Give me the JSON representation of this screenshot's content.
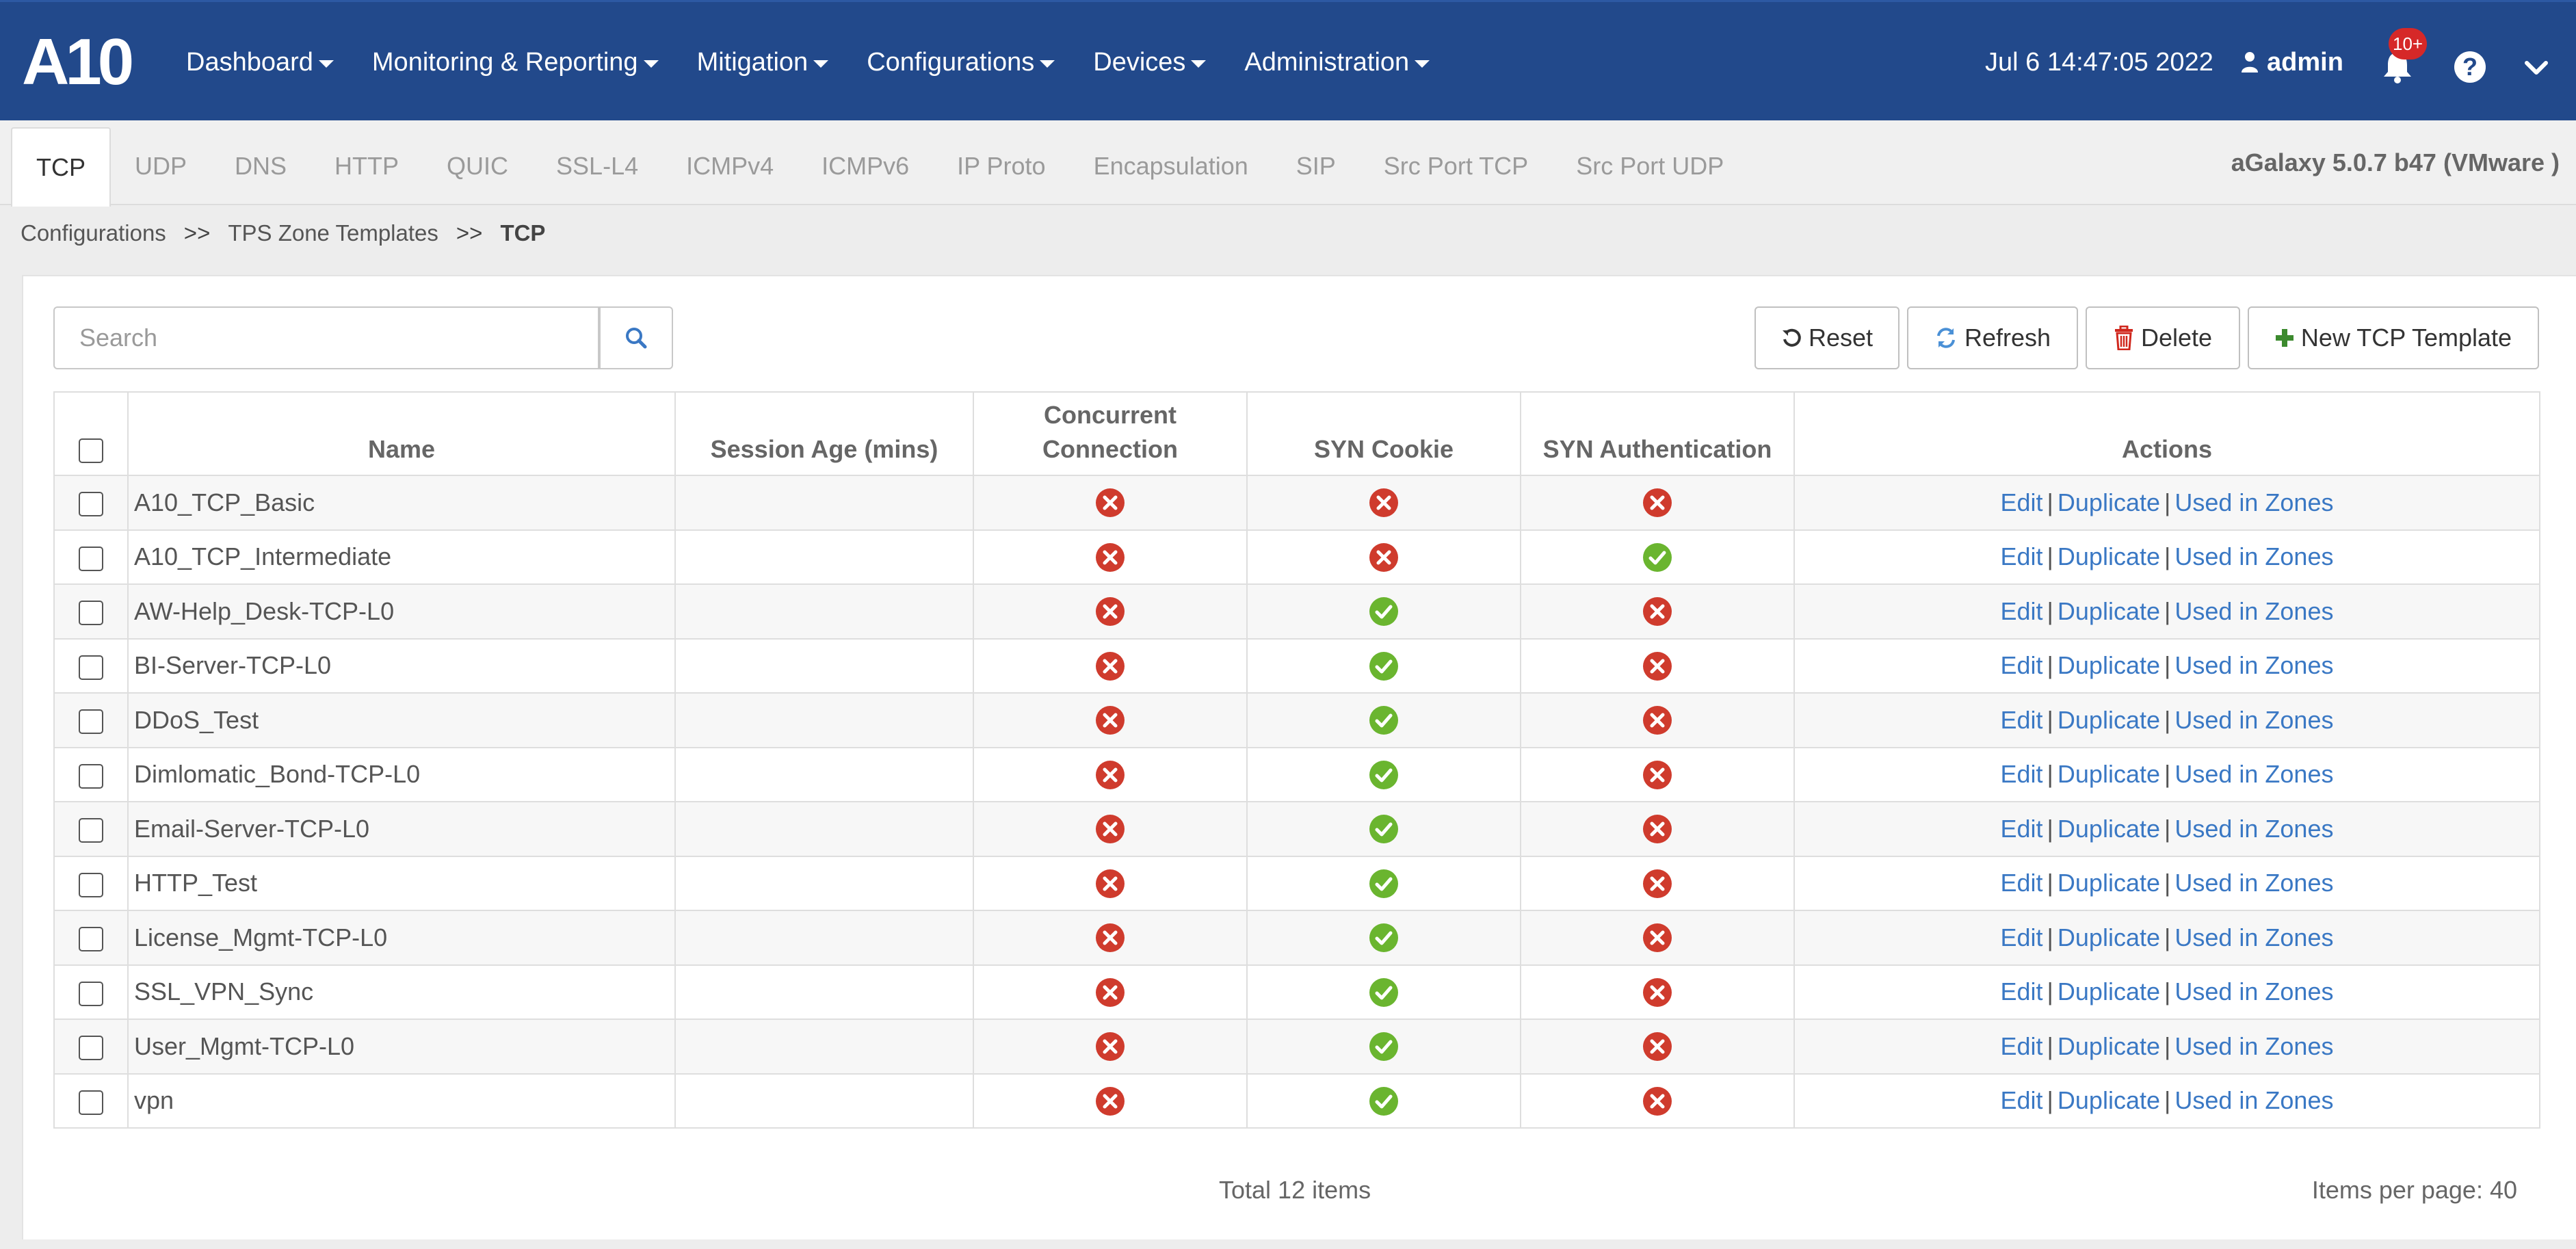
{
  "nav": {
    "logo_text": "A10",
    "menus": [
      {
        "label": "Dashboard",
        "name": "menu-dashboard"
      },
      {
        "label": "Monitoring & Reporting",
        "name": "menu-monitoring-reporting"
      },
      {
        "label": "Mitigation",
        "name": "menu-mitigation"
      },
      {
        "label": "Configurations",
        "name": "menu-configurations"
      },
      {
        "label": "Devices",
        "name": "menu-devices"
      },
      {
        "label": "Administration",
        "name": "menu-administration"
      }
    ],
    "datetime": "Jul 6 14:47:05 2022",
    "user": "admin",
    "notification_badge": "10+",
    "help_glyph": "?"
  },
  "tabs": [
    {
      "label": "TCP",
      "active": true
    },
    {
      "label": "UDP"
    },
    {
      "label": "DNS"
    },
    {
      "label": "HTTP"
    },
    {
      "label": "QUIC"
    },
    {
      "label": "SSL-L4"
    },
    {
      "label": "ICMPv4"
    },
    {
      "label": "ICMPv6"
    },
    {
      "label": "IP Proto"
    },
    {
      "label": "Encapsulation"
    },
    {
      "label": "SIP"
    },
    {
      "label": "Src Port TCP"
    },
    {
      "label": "Src Port UDP"
    }
  ],
  "version": "aGalaxy 5.0.7 b47 (VMware )",
  "breadcrumb": {
    "items": [
      "Configurations",
      "TPS Zone Templates",
      "TCP"
    ],
    "separator": ">>"
  },
  "search": {
    "placeholder": "Search"
  },
  "toolbar": {
    "reset": "Reset",
    "refresh": "Refresh",
    "delete": "Delete",
    "new": "New TCP Template"
  },
  "table": {
    "headers": {
      "name": "Name",
      "session_age": "Session Age (mins)",
      "concurrent_line1": "Concurrent",
      "concurrent_line2": "Connection",
      "syn_cookie": "SYN Cookie",
      "syn_auth": "SYN Authentication",
      "actions": "Actions"
    },
    "action_labels": {
      "edit": "Edit",
      "duplicate": "Duplicate",
      "used": "Used in Zones",
      "separator": "|"
    },
    "rows": [
      {
        "name": "A10_TCP_Basic",
        "session_age": "",
        "concurrent": false,
        "syn_cookie": false,
        "syn_auth": false
      },
      {
        "name": "A10_TCP_Intermediate",
        "session_age": "",
        "concurrent": false,
        "syn_cookie": false,
        "syn_auth": true
      },
      {
        "name": "AW-Help_Desk-TCP-L0",
        "session_age": "",
        "concurrent": false,
        "syn_cookie": true,
        "syn_auth": false
      },
      {
        "name": "BI-Server-TCP-L0",
        "session_age": "",
        "concurrent": false,
        "syn_cookie": true,
        "syn_auth": false
      },
      {
        "name": "DDoS_Test",
        "session_age": "",
        "concurrent": false,
        "syn_cookie": true,
        "syn_auth": false
      },
      {
        "name": "Dimlomatic_Bond-TCP-L0",
        "session_age": "",
        "concurrent": false,
        "syn_cookie": true,
        "syn_auth": false
      },
      {
        "name": "Email-Server-TCP-L0",
        "session_age": "",
        "concurrent": false,
        "syn_cookie": true,
        "syn_auth": false
      },
      {
        "name": "HTTP_Test",
        "session_age": "",
        "concurrent": false,
        "syn_cookie": true,
        "syn_auth": false
      },
      {
        "name": "License_Mgmt-TCP-L0",
        "session_age": "",
        "concurrent": false,
        "syn_cookie": true,
        "syn_auth": false
      },
      {
        "name": "SSL_VPN_Sync",
        "session_age": "",
        "concurrent": false,
        "syn_cookie": true,
        "syn_auth": false
      },
      {
        "name": "User_Mgmt-TCP-L0",
        "session_age": "",
        "concurrent": false,
        "syn_cookie": true,
        "syn_auth": false
      },
      {
        "name": "vpn",
        "session_age": "",
        "concurrent": false,
        "syn_cookie": true,
        "syn_auth": false
      }
    ]
  },
  "footer": {
    "total": "Total 12 items",
    "per_page": "Items per page: 40"
  },
  "colors": {
    "nav_bg": "#22498b",
    "link": "#3a78c4",
    "status_ok": "#6ab52f",
    "status_no": "#cf3b2d",
    "delete_icon": "#d0281e",
    "new_icon": "#3c8a2e",
    "refresh_icon": "#4a90d6"
  }
}
